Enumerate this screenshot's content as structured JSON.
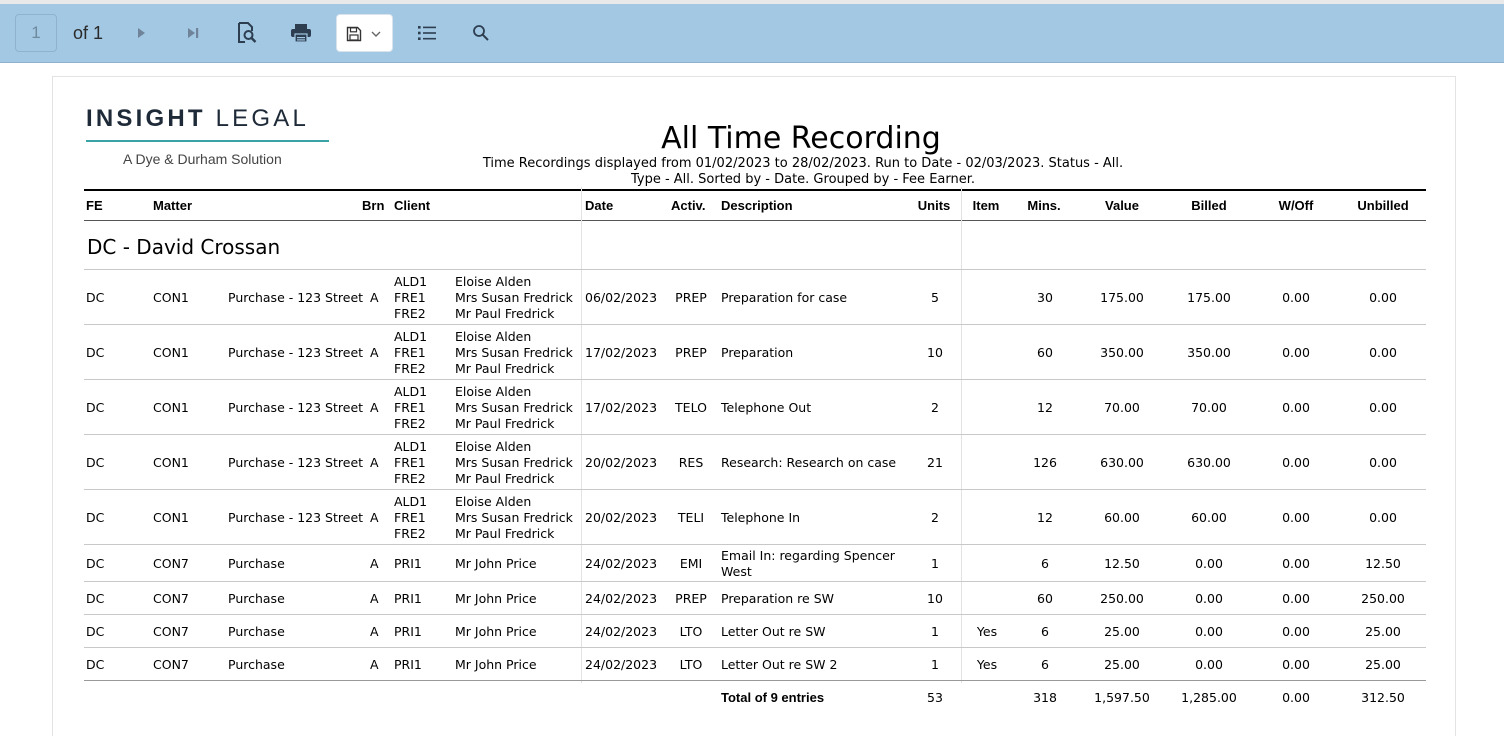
{
  "toolbar": {
    "page_value": "1",
    "of_label": "of 1",
    "icons": [
      "next-page-icon",
      "last-page-icon",
      "search-document-icon",
      "print-icon",
      "save-icon",
      "chevron-down-icon",
      "document-map-icon",
      "search-icon"
    ]
  },
  "logo": {
    "main_bold": "INSIGHT",
    "main_thin": "LEGAL",
    "subtitle": "A Dye & Durham Solution",
    "accent_color": "#3aa3a8"
  },
  "report": {
    "title": "All Time Recording",
    "subtitle_1": "Time Recordings displayed from 01/02/2023 to 28/02/2023. Run to Date - 02/03/2023. Status - All.",
    "subtitle_2": "Type - All. Sorted by - Date. Grouped by - Fee Earner."
  },
  "columns": {
    "fe": "FE",
    "matter": "Matter",
    "brn": "Brn",
    "client": "Client",
    "date": "Date",
    "activ": "Activ.",
    "description": "Description",
    "units": "Units",
    "item": "Item",
    "mins": "Mins.",
    "value": "Value",
    "billed": "Billed",
    "woff": "W/Off",
    "unbilled": "Unbilled"
  },
  "group": {
    "title": "DC - David Crossan"
  },
  "rows": [
    {
      "fe": "DC",
      "matter": "CON1",
      "matter_desc": "Purchase - 123 Street",
      "brn": "A",
      "client_codes": [
        "ALD1",
        "FRE1",
        "FRE2"
      ],
      "client_names": [
        "Eloise Alden",
        "Mrs Susan Fredrick",
        "Mr Paul Fredrick"
      ],
      "date": "06/02/2023",
      "activ": "PREP",
      "description": "Preparation for case",
      "units": "5",
      "item": "",
      "mins": "30",
      "value": "175.00",
      "billed": "175.00",
      "woff": "0.00",
      "unbilled": "0.00"
    },
    {
      "fe": "DC",
      "matter": "CON1",
      "matter_desc": "Purchase - 123 Street",
      "brn": "A",
      "client_codes": [
        "ALD1",
        "FRE1",
        "FRE2"
      ],
      "client_names": [
        "Eloise Alden",
        "Mrs Susan Fredrick",
        "Mr Paul Fredrick"
      ],
      "date": "17/02/2023",
      "activ": "PREP",
      "description": "Preparation",
      "units": "10",
      "item": "",
      "mins": "60",
      "value": "350.00",
      "billed": "350.00",
      "woff": "0.00",
      "unbilled": "0.00"
    },
    {
      "fe": "DC",
      "matter": "CON1",
      "matter_desc": "Purchase - 123 Street",
      "brn": "A",
      "client_codes": [
        "ALD1",
        "FRE1",
        "FRE2"
      ],
      "client_names": [
        "Eloise Alden",
        "Mrs Susan Fredrick",
        "Mr Paul Fredrick"
      ],
      "date": "17/02/2023",
      "activ": "TELO",
      "description": "Telephone Out",
      "units": "2",
      "item": "",
      "mins": "12",
      "value": "70.00",
      "billed": "70.00",
      "woff": "0.00",
      "unbilled": "0.00"
    },
    {
      "fe": "DC",
      "matter": "CON1",
      "matter_desc": "Purchase - 123 Street",
      "brn": "A",
      "client_codes": [
        "ALD1",
        "FRE1",
        "FRE2"
      ],
      "client_names": [
        "Eloise Alden",
        "Mrs Susan Fredrick",
        "Mr Paul Fredrick"
      ],
      "date": "20/02/2023",
      "activ": "RES",
      "description": "Research: Research on case",
      "units": "21",
      "item": "",
      "mins": "126",
      "value": "630.00",
      "billed": "630.00",
      "woff": "0.00",
      "unbilled": "0.00"
    },
    {
      "fe": "DC",
      "matter": "CON1",
      "matter_desc": "Purchase - 123 Street",
      "brn": "A",
      "client_codes": [
        "ALD1",
        "FRE1",
        "FRE2"
      ],
      "client_names": [
        "Eloise Alden",
        "Mrs Susan Fredrick",
        "Mr Paul Fredrick"
      ],
      "date": "20/02/2023",
      "activ": "TELI",
      "description": "Telephone In",
      "units": "2",
      "item": "",
      "mins": "12",
      "value": "60.00",
      "billed": "60.00",
      "woff": "0.00",
      "unbilled": "0.00"
    },
    {
      "fe": "DC",
      "matter": "CON7",
      "matter_desc": "Purchase",
      "brn": "A",
      "client_codes": [
        "PRI1"
      ],
      "client_names": [
        "Mr John Price"
      ],
      "date": "24/02/2023",
      "activ": "EMI",
      "description": "Email In: regarding Spencer West",
      "units": "1",
      "item": "",
      "mins": "6",
      "value": "12.50",
      "billed": "0.00",
      "woff": "0.00",
      "unbilled": "12.50"
    },
    {
      "fe": "DC",
      "matter": "CON7",
      "matter_desc": "Purchase",
      "brn": "A",
      "client_codes": [
        "PRI1"
      ],
      "client_names": [
        "Mr John Price"
      ],
      "date": "24/02/2023",
      "activ": "PREP",
      "description": "Preparation re SW",
      "units": "10",
      "item": "",
      "mins": "60",
      "value": "250.00",
      "billed": "0.00",
      "woff": "0.00",
      "unbilled": "250.00"
    },
    {
      "fe": "DC",
      "matter": "CON7",
      "matter_desc": "Purchase",
      "brn": "A",
      "client_codes": [
        "PRI1"
      ],
      "client_names": [
        "Mr John Price"
      ],
      "date": "24/02/2023",
      "activ": "LTO",
      "description": "Letter Out re SW",
      "units": "1",
      "item": "Yes",
      "mins": "6",
      "value": "25.00",
      "billed": "0.00",
      "woff": "0.00",
      "unbilled": "25.00"
    },
    {
      "fe": "DC",
      "matter": "CON7",
      "matter_desc": "Purchase",
      "brn": "A",
      "client_codes": [
        "PRI1"
      ],
      "client_names": [
        "Mr John Price"
      ],
      "date": "24/02/2023",
      "activ": "LTO",
      "description": "Letter Out re SW 2",
      "units": "1",
      "item": "Yes",
      "mins": "6",
      "value": "25.00",
      "billed": "0.00",
      "woff": "0.00",
      "unbilled": "25.00"
    }
  ],
  "total": {
    "label": "Total of 9 entries",
    "units": "53",
    "mins": "318",
    "value": "1,597.50",
    "billed": "1,285.00",
    "woff": "0.00",
    "unbilled": "312.50"
  },
  "colors": {
    "toolbar_bg": "#a3c8e3"
  }
}
